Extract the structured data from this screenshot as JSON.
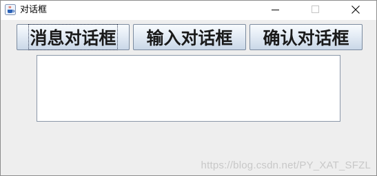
{
  "window": {
    "title": "对话框",
    "app_icon": "java-coffee-cup-icon",
    "controls": [
      "minimize-icon",
      "maximize-icon",
      "close-icon"
    ]
  },
  "buttons": {
    "message": "消息对话框",
    "input": "输入对话框",
    "confirm": "确认对话框"
  },
  "text_area": {
    "value": ""
  },
  "watermark": "https://blog.csdn.net/PY_XAT_SFZL",
  "colors": {
    "titlebar_bg": "#ffffff",
    "window_bg": "#eeeeee",
    "button_gradient_top": "#f8fbfe",
    "button_gradient_bottom": "#c9d7e7",
    "button_border": "#7a8a9e"
  }
}
